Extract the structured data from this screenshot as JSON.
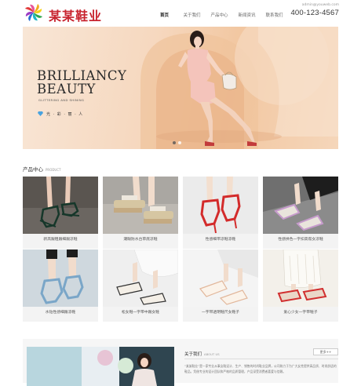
{
  "header": {
    "brand": "某某鞋业",
    "logo_icon": "rainbow-swirl-logo",
    "nav": [
      {
        "label": "首页",
        "active": true
      },
      {
        "label": "关于我们",
        "active": false
      },
      {
        "label": "产品中心",
        "active": false
      },
      {
        "label": "新闻资讯",
        "active": false
      },
      {
        "label": "联系我们",
        "active": false
      }
    ],
    "email": "admin@youweb.com",
    "phone": "400-123-4567"
  },
  "banner": {
    "title_line1": "BRILLIANCY",
    "title_line2": "BEAUTY",
    "subtitle": "GLITTERING AND SHINING",
    "tagline": "光 · 彩 · 丽 · 人",
    "slide_count": 2,
    "active_slide": 1
  },
  "products": {
    "title": "产品中心",
    "title_en": "PRODUCT",
    "items": [
      {
        "label": "新高跟粗跟细跟凉鞋"
      },
      {
        "label": "潮眼防水台草底凉鞋"
      },
      {
        "label": "性感细带凉鞋凉鞋"
      },
      {
        "label": "性感拼色一字扣高帮女凉鞋"
      },
      {
        "label": "水钻性感细跟凉鞋"
      },
      {
        "label": "松女鞋一字带中跟女鞋"
      },
      {
        "label": "一字带透明鞋尺女鞋子"
      },
      {
        "label": "爱心少女一字带鞋子"
      }
    ]
  },
  "about": {
    "title": "关于我们",
    "title_en": "ABOUT US",
    "more_label": "更多++",
    "text": "“某某鞋业”是一家专业从事女鞋设计、生产、销售的时尚鞋业品牌，公司致力于为广大女性提供高品质、时尚舒适的鞋品。凭借专业的设计团队和严格的品质管理，产品深受消费者喜爱与信赖。"
  }
}
